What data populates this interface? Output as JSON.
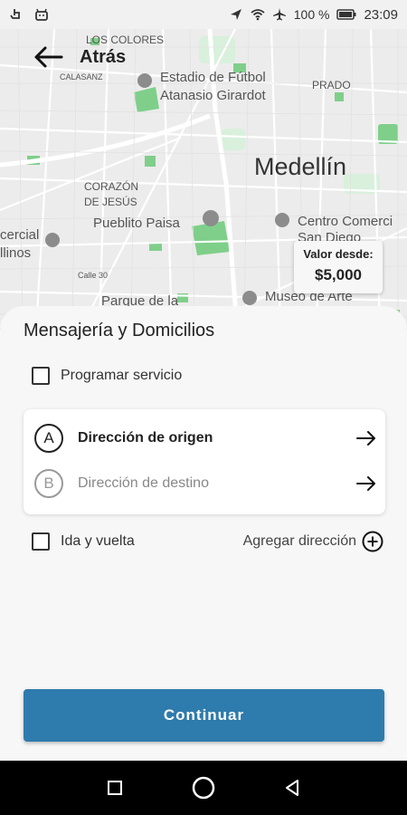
{
  "status_bar": {
    "battery": "100 %",
    "time": "23:09",
    "icons": [
      "touch-icon",
      "android-icon",
      "location-icon",
      "wifi-icon",
      "airplane-icon",
      "battery-icon"
    ]
  },
  "header": {
    "back_label": "Atrás"
  },
  "map": {
    "labels": {
      "los_colores": "LOS COLORES",
      "calasanz": "CALASANZ",
      "estadio_1": "Estadio de Fútbol",
      "estadio_2": "Atanasio Girardot",
      "prado": "PRADO",
      "city": "Medellín",
      "corazon_1": "CORAZÓN",
      "corazon_2": "DE JESÚS",
      "pueblito": "Pueblito Paisa",
      "centro_1": "Centro Comerci",
      "centro_2": "San Diego",
      "comercial_1": "cercial",
      "comercial_2": "llinos",
      "calle30": "Calle 30",
      "parque": "Parque de la",
      "museo": "Museo de Arte"
    }
  },
  "price_bubble": {
    "label": "Valor desde:",
    "value": "$5,000"
  },
  "sheet": {
    "title": "Mensajería y Domicilios",
    "schedule_label": "Programar servicio",
    "origin_badge": "A",
    "origin_label": "Dirección de origen",
    "destination_badge": "B",
    "destination_label": "Dirección de destino",
    "round_trip_label": "Ida y vuelta",
    "add_address_label": "Agregar dirección",
    "continue_label": "Continuar"
  },
  "colors": {
    "primary_button": "#2e7bad",
    "map_background": "#ececec",
    "park_green": "#7fcf8a"
  }
}
